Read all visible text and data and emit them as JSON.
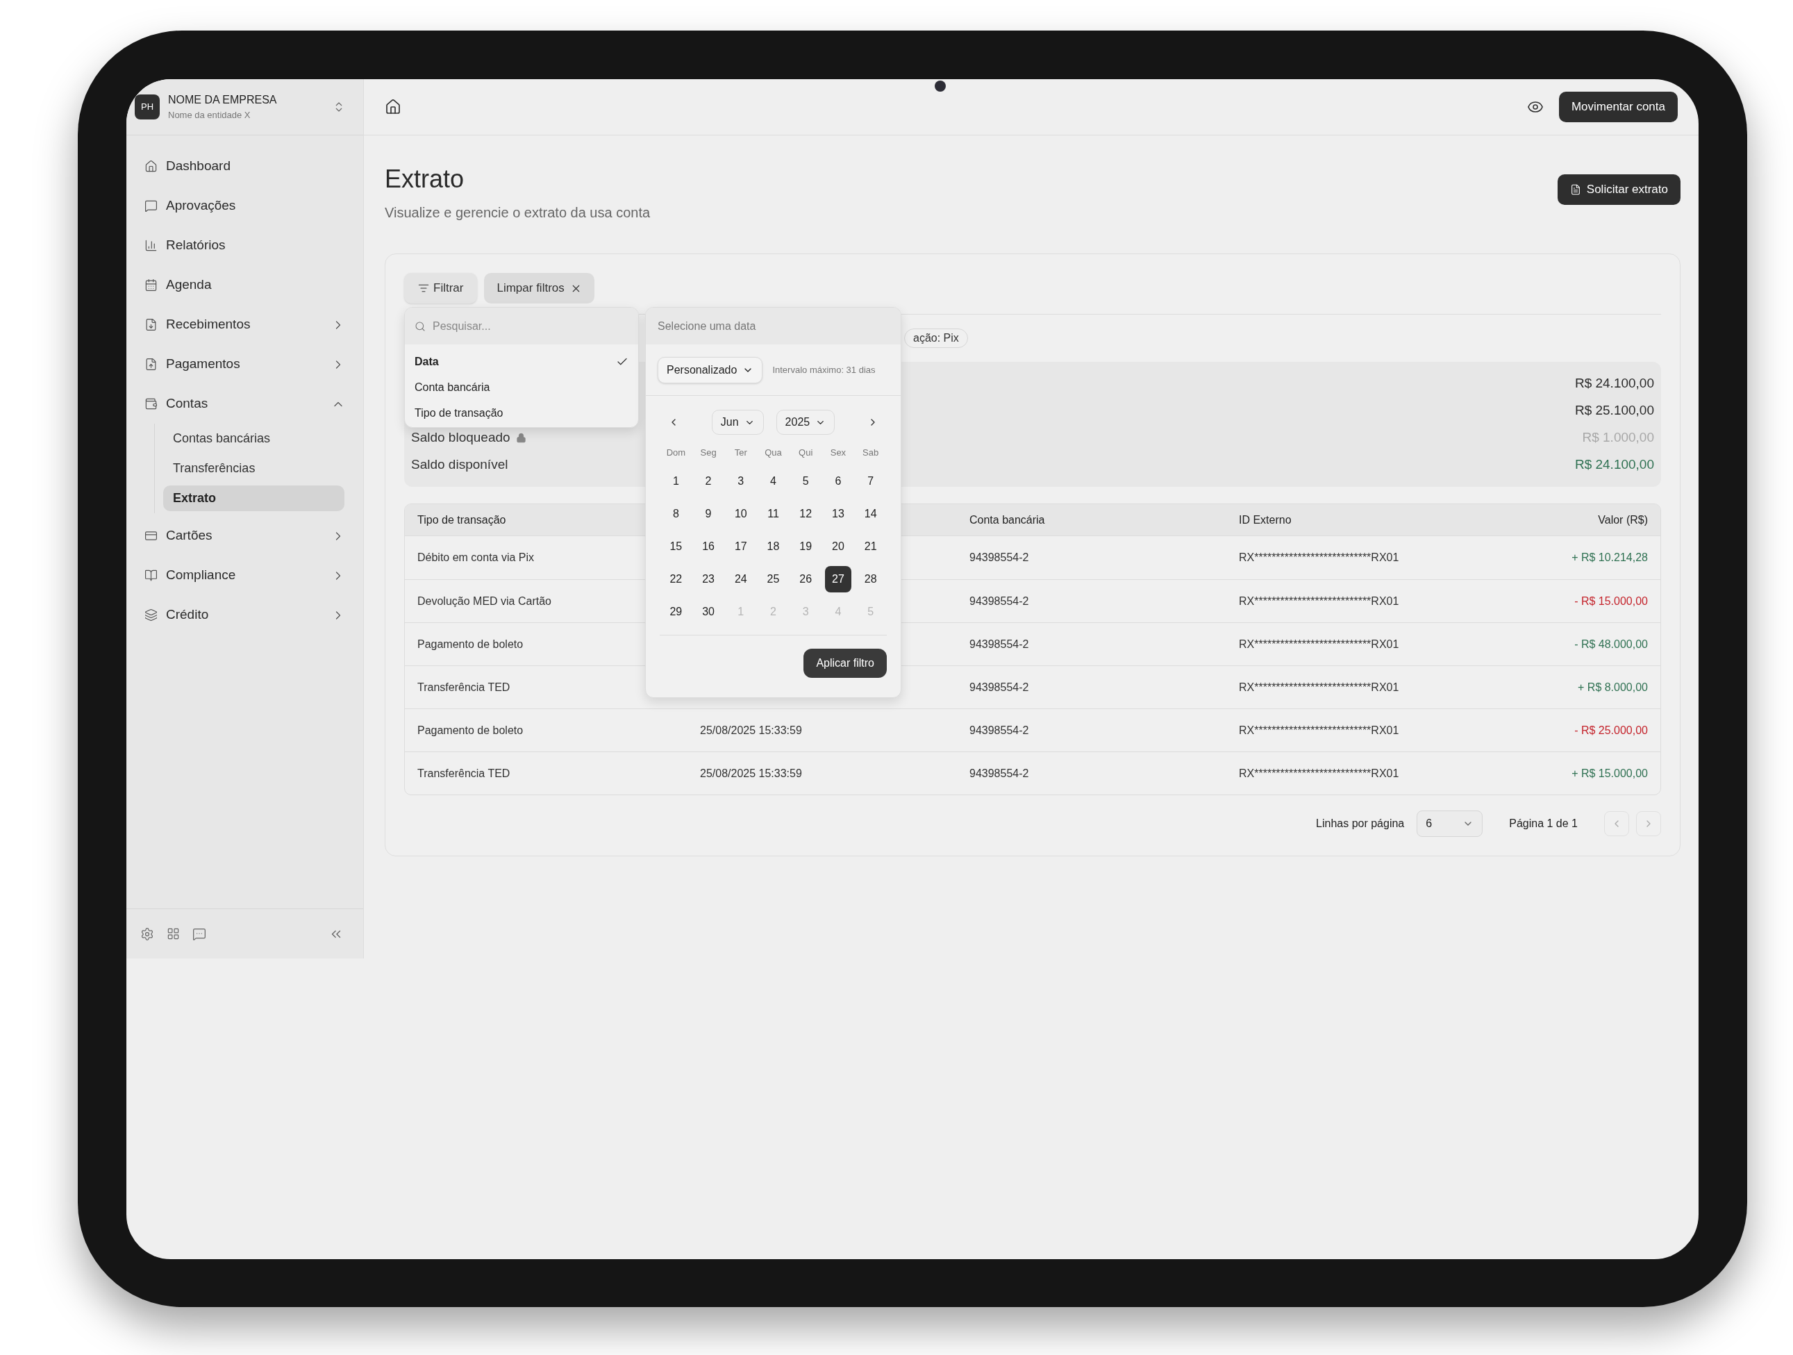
{
  "company": {
    "initials": "PH",
    "name": "NOME DA EMPRESA",
    "entity": "Nome da entidade X"
  },
  "nav": [
    {
      "label": "Dashboard",
      "selected": false
    },
    {
      "label": "Aprovações",
      "selected": false
    },
    {
      "label": "Relatórios",
      "selected": false
    },
    {
      "label": "Agenda",
      "selected": false
    },
    {
      "label": "Recebimentos",
      "selected": false,
      "expanded": false
    },
    {
      "label": "Pagamentos",
      "selected": false,
      "expanded": false
    },
    {
      "label": "Contas",
      "selected": false,
      "expanded": true,
      "children": [
        {
          "label": "Contas bancárias",
          "selected": false
        },
        {
          "label": "Transferências",
          "selected": false
        },
        {
          "label": "Extrato",
          "selected": true
        }
      ]
    },
    {
      "label": "Cartões",
      "selected": false,
      "expanded": false
    },
    {
      "label": "Compliance",
      "selected": false,
      "expanded": false
    },
    {
      "label": "Crédito",
      "selected": false,
      "expanded": false
    }
  ],
  "header": {
    "action": "Movimentar conta"
  },
  "page": {
    "title": "Extrato",
    "subtitle": "Visualize e gerencie o extrato da usa conta",
    "action": "Solicitar extrato"
  },
  "filters": {
    "filter_button": "Filtrar",
    "clear_button": "Limpar filtros",
    "chips": [
      "ação: Pix"
    ]
  },
  "filter_menu": {
    "placeholder": "Pesquisar...",
    "options": [
      {
        "label": "Data",
        "selected": true
      },
      {
        "label": "Conta bancária",
        "selected": false
      },
      {
        "label": "Tipo de transação",
        "selected": false
      }
    ]
  },
  "date_picker": {
    "title": "Selecione uma data",
    "mode": "Personalizado",
    "note": "Intervalo máximo: 31 dias",
    "month": "Jun",
    "year": "2025",
    "weekdays": [
      "Dom",
      "Seg",
      "Ter",
      "Qua",
      "Qui",
      "Sex",
      "Sab"
    ],
    "apply": "Aplicar filtro",
    "days": [
      {
        "label": "1",
        "outside": false,
        "selected": false
      },
      {
        "label": "2",
        "outside": false,
        "selected": false
      },
      {
        "label": "3",
        "outside": false,
        "selected": false
      },
      {
        "label": "4",
        "outside": false,
        "selected": false
      },
      {
        "label": "5",
        "outside": false,
        "selected": false
      },
      {
        "label": "6",
        "outside": false,
        "selected": false
      },
      {
        "label": "7",
        "outside": false,
        "selected": false
      },
      {
        "label": "8",
        "outside": false,
        "selected": false
      },
      {
        "label": "9",
        "outside": false,
        "selected": false
      },
      {
        "label": "10",
        "outside": false,
        "selected": false
      },
      {
        "label": "11",
        "outside": false,
        "selected": false
      },
      {
        "label": "12",
        "outside": false,
        "selected": false
      },
      {
        "label": "13",
        "outside": false,
        "selected": false
      },
      {
        "label": "14",
        "outside": false,
        "selected": false
      },
      {
        "label": "15",
        "outside": false,
        "selected": false
      },
      {
        "label": "16",
        "outside": false,
        "selected": false
      },
      {
        "label": "17",
        "outside": false,
        "selected": false
      },
      {
        "label": "18",
        "outside": false,
        "selected": false
      },
      {
        "label": "19",
        "outside": false,
        "selected": false
      },
      {
        "label": "20",
        "outside": false,
        "selected": false
      },
      {
        "label": "21",
        "outside": false,
        "selected": false
      },
      {
        "label": "22",
        "outside": false,
        "selected": false
      },
      {
        "label": "23",
        "outside": false,
        "selected": false
      },
      {
        "label": "24",
        "outside": false,
        "selected": false
      },
      {
        "label": "25",
        "outside": false,
        "selected": false
      },
      {
        "label": "26",
        "outside": false,
        "selected": false
      },
      {
        "label": "27",
        "outside": false,
        "selected": true
      },
      {
        "label": "28",
        "outside": false,
        "selected": false
      },
      {
        "label": "29",
        "outside": false,
        "selected": false
      },
      {
        "label": "30",
        "outside": false,
        "selected": false
      },
      {
        "label": "1",
        "outside": true,
        "selected": false
      },
      {
        "label": "2",
        "outside": true,
        "selected": false
      },
      {
        "label": "3",
        "outside": true,
        "selected": false
      },
      {
        "label": "4",
        "outside": true,
        "selected": false
      },
      {
        "label": "5",
        "outside": true,
        "selected": false
      }
    ]
  },
  "balances": [
    {
      "value": "R$ 24.100,00",
      "color": "#2a2a2a"
    },
    {
      "value": "R$ 25.100,00",
      "color": "#2a2a2a"
    },
    {
      "label": "Saldo bloqueado",
      "locked": true,
      "value": "R$ 1.000,00",
      "color": "#a8a8a8"
    },
    {
      "label": "Saldo disponível",
      "locked": false,
      "value": "R$ 24.100,00",
      "color": "#2f7152"
    }
  ],
  "table": {
    "header": {
      "type": "Tipo de transação",
      "account": "Conta bancária",
      "external_id": "ID Externo",
      "value": "Valor (R$)"
    },
    "rows": [
      {
        "type": "Débito em conta via Pix",
        "account": "94398554-2",
        "external_id": "RX***************************RX01",
        "value": "+ R$ 10.214,28",
        "color": "#2f7152"
      },
      {
        "type": "Devolução MED via Cartão",
        "account": "94398554-2",
        "external_id": "RX***************************RX01",
        "value": "- R$ 15.000,00",
        "color": "#c4232b"
      },
      {
        "type": "Pagamento de boleto",
        "account": "94398554-2",
        "external_id": "RX***************************RX01",
        "value": "- R$ 48.000,00",
        "color": "#2f7152"
      },
      {
        "type": "Transferência TED",
        "account": "94398554-2",
        "external_id": "RX***************************RX01",
        "value": "+ R$ 8.000,00",
        "color": "#2f7152"
      },
      {
        "type": "Pagamento de boleto",
        "date": "25/08/2025 15:33:59",
        "account": "94398554-2",
        "external_id": "RX***************************RX01",
        "value": "- R$ 25.000,00",
        "color": "#c4232b"
      },
      {
        "type": "Transferência TED",
        "date": "25/08/2025 15:33:59",
        "account": "94398554-2",
        "external_id": "RX***************************RX01",
        "value": "+ R$ 15.000,00",
        "color": "#2f7152"
      }
    ]
  },
  "pagination": {
    "label": "Linhas por página",
    "rows_per_page": "6",
    "page": "Página 1 de 1"
  }
}
